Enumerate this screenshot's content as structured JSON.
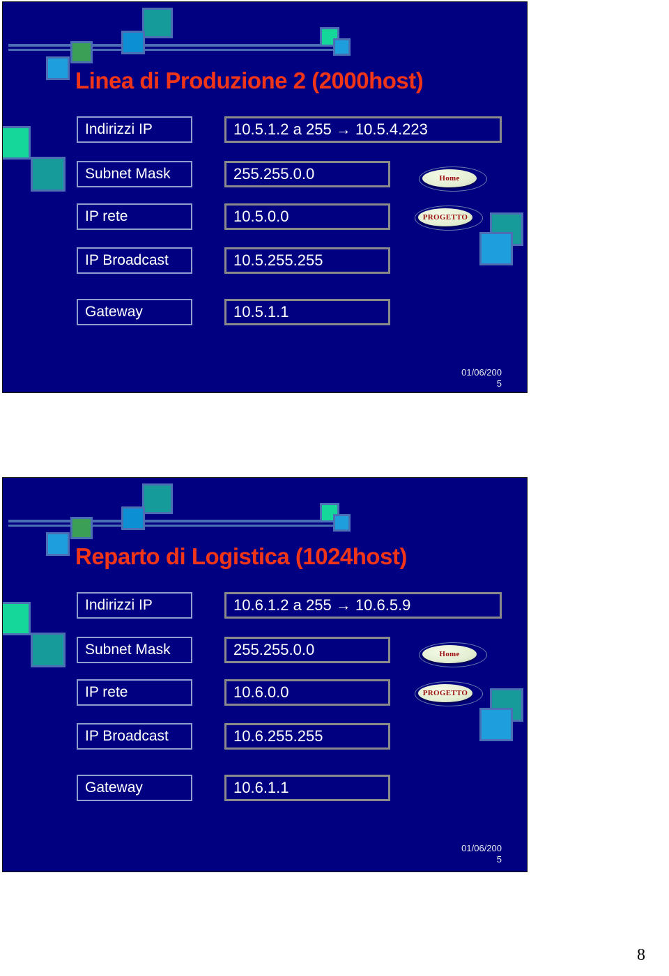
{
  "document": {
    "page_number": "8",
    "background": "#ffffff"
  },
  "colors": {
    "slide_background": "#000080",
    "title": "#f03518",
    "label_border": "#8e9fd0",
    "value_border": "#8a8a8a",
    "text": "#ffffff",
    "nav_button_text": "#9a1010",
    "deco_bar": "#4a6fb5",
    "deco_teal": "#179a9a",
    "deco_green": "#3ba055",
    "deco_blue": "#1f9ede",
    "deco_spring": "#15d79a"
  },
  "slides": [
    {
      "title": "Linea di Produzione 2 (2000host)",
      "rows": [
        {
          "label": "Indirizzi IP",
          "value": "10.5.1.2 a 255  →  10.5.4.223",
          "width": "wide"
        },
        {
          "label": "Subnet Mask",
          "value": "255.255.0.0",
          "width": "narrow"
        },
        {
          "label": "IP rete",
          "value": "10.5.0.0",
          "width": "narrow"
        },
        {
          "label": "IP Broadcast",
          "value": "10.5.255.255",
          "width": "narrow"
        },
        {
          "label": "Gateway",
          "value": "10.5.1.1",
          "width": "narrow"
        }
      ],
      "buttons": [
        {
          "name": "home-button",
          "label": "Home"
        },
        {
          "name": "progetto-button",
          "label": "PROGETTO"
        }
      ],
      "footer_date_line1": "01/06/200",
      "footer_date_line2": "5"
    },
    {
      "title": "Reparto di Logistica (1024host)",
      "rows": [
        {
          "label": "Indirizzi IP",
          "value": "10.6.1.2 a 255  →  10.6.5.9",
          "width": "wide"
        },
        {
          "label": "Subnet Mask",
          "value": "255.255.0.0",
          "width": "narrow"
        },
        {
          "label": "IP rete",
          "value": "10.6.0.0",
          "width": "narrow"
        },
        {
          "label": "IP Broadcast",
          "value": "10.6.255.255",
          "width": "narrow"
        },
        {
          "label": "Gateway",
          "value": "10.6.1.1",
          "width": "narrow"
        }
      ],
      "buttons": [
        {
          "name": "home-button",
          "label": "Home"
        },
        {
          "name": "progetto-button",
          "label": "PROGETTO"
        }
      ],
      "footer_date_line1": "01/06/200",
      "footer_date_line2": "5"
    }
  ]
}
